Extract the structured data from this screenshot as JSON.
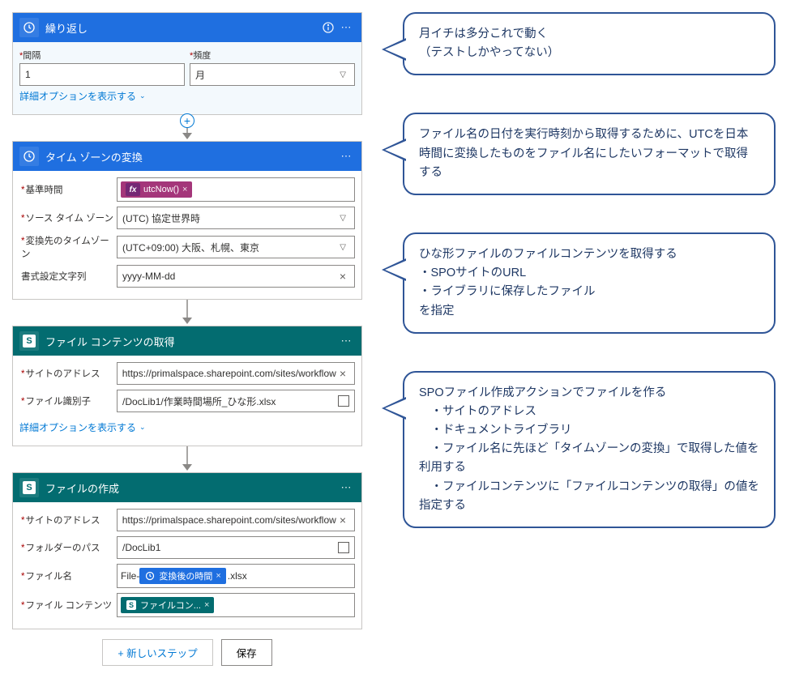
{
  "recurrence": {
    "title": "繰り返し",
    "interval_label": "間隔",
    "interval_value": "1",
    "frequency_label": "頻度",
    "frequency_value": "月",
    "advanced": "詳細オプションを表示する"
  },
  "tzconv": {
    "title": "タイム ゾーンの変換",
    "base_time_label": "基準時間",
    "base_time_pill": "utcNow()",
    "src_tz_label": "ソース タイム ゾーン",
    "src_tz_value": "(UTC) 協定世界時",
    "dst_tz_label": "変換先のタイムゾーン",
    "dst_tz_value": "(UTC+09:00) 大阪、札幌、東京",
    "format_label": "書式設定文字列",
    "format_value": "yyyy-MM-dd"
  },
  "getcontent": {
    "title": "ファイル コンテンツの取得",
    "site_label": "サイトのアドレス",
    "site_value": "https://primalspace.sharepoint.com/sites/workflow",
    "file_id_label": "ファイル識別子",
    "file_id_value": "/DocLib1/作業時間場所_ひな形.xlsx",
    "advanced": "詳細オプションを表示する"
  },
  "createfile": {
    "title": "ファイルの作成",
    "site_label": "サイトのアドレス",
    "site_value": "https://primalspace.sharepoint.com/sites/workflow",
    "folder_label": "フォルダーのパス",
    "folder_value": "/DocLib1",
    "filename_label": "ファイル名",
    "filename_prefix": "File-",
    "filename_pill": "変換後の時間",
    "filename_suffix": ".xlsx",
    "content_label": "ファイル コンテンツ",
    "content_pill": "ファイルコン..."
  },
  "buttons": {
    "new_step": "+ 新しいステップ",
    "save": "保存"
  },
  "bubbles": {
    "b1": "月イチは多分これで動く\n（テストしかやってない）",
    "b2": "ファイル名の日付を実行時刻から取得するために、UTCを日本時間に変換したものをファイル名にしたいフォーマットで取得する",
    "b3": "ひな形ファイルのファイルコンテンツを取得する\n・SPOサイトのURL\n・ライブラリに保存したファイル\nを指定",
    "b4": "SPOファイル作成アクションでファイルを作る\n　・サイトのアドレス\n　・ドキュメントライブラリ\n　・ファイル名に先ほど「タイムゾーンの変換」で取得した値を利用する\n　・ファイルコンテンツに「ファイルコンテンツの取得」の値を指定する"
  }
}
